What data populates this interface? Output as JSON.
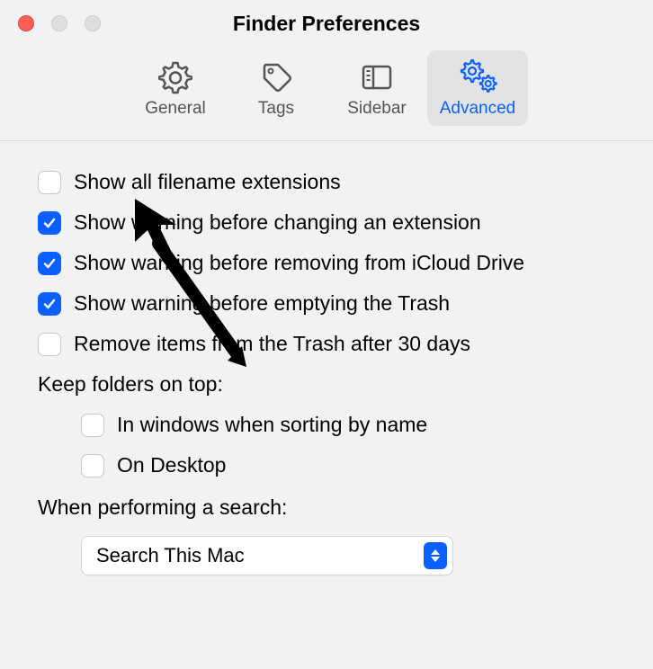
{
  "window": {
    "title": "Finder Preferences"
  },
  "toolbar": {
    "general": "General",
    "tags": "Tags",
    "sidebar": "Sidebar",
    "advanced": "Advanced",
    "selected": "advanced"
  },
  "options": {
    "show_extensions": {
      "label": "Show all filename extensions",
      "checked": false
    },
    "warn_extension": {
      "label": "Show warning before changing an extension",
      "checked": true
    },
    "warn_icloud": {
      "label": "Show warning before removing from iCloud Drive",
      "checked": true
    },
    "warn_trash": {
      "label": "Show warning before emptying the Trash",
      "checked": true
    },
    "auto_trash": {
      "label": "Remove items from the Trash after 30 days",
      "checked": false
    }
  },
  "folders_heading": "Keep folders on top:",
  "folders": {
    "in_windows": {
      "label": "In windows when sorting by name",
      "checked": false
    },
    "on_desktop": {
      "label": "On Desktop",
      "checked": false
    }
  },
  "search_heading": "When performing a search:",
  "search_select": {
    "value": "Search This Mac"
  }
}
